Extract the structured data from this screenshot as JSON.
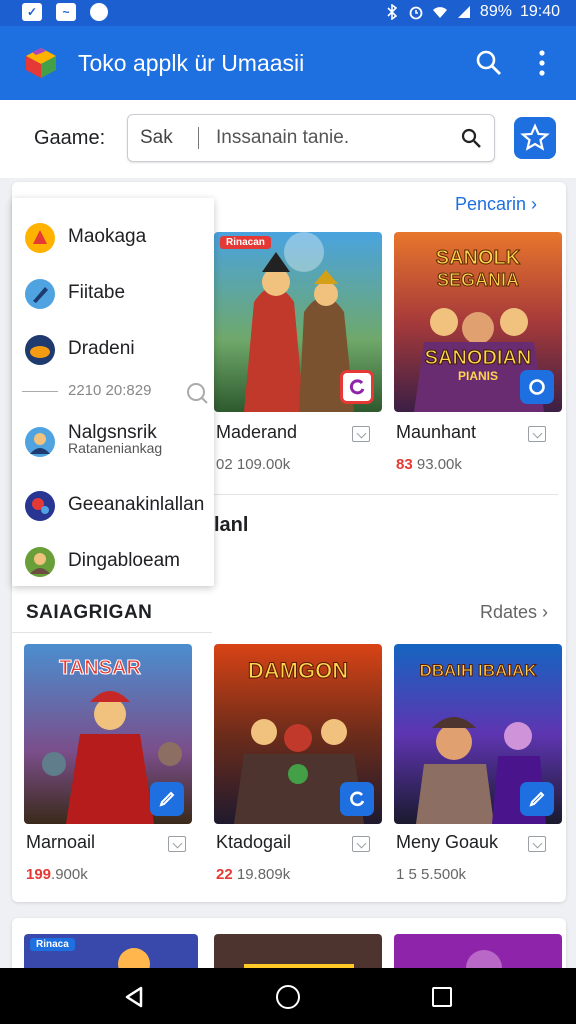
{
  "status_bar": {
    "battery": "89%",
    "time": "19:40"
  },
  "app_bar": {
    "title": "Toko applk ür Umaasii"
  },
  "filter": {
    "label": "Gaame:",
    "search_value": "Sak",
    "search_placeholder": "Inssanain tanie."
  },
  "featured": {
    "more_label": "Pencarin",
    "partial_title": "lanl",
    "tiles": [
      {
        "name": "Maderand",
        "meta_prefix": "",
        "meta": "02 109.00k",
        "tag": "Rinacan",
        "icon": "refresh-icon"
      },
      {
        "name": "Maunhant",
        "meta_prefix": "83",
        "meta": "93.00k",
        "tag": "",
        "icon": "sync-icon"
      }
    ]
  },
  "side_menu": {
    "items": [
      {
        "label": "Maokaga",
        "icon": "tag-icon"
      },
      {
        "label": "Fiitabe",
        "icon": "pencil-icon"
      },
      {
        "label": "Dradeni",
        "icon": "game-icon"
      },
      {
        "label": "Nalgsnsrik",
        "sublabel": "Rataneniankag",
        "icon": "avatar-icon"
      },
      {
        "label": "Geeanakinlallan",
        "icon": "planet-icon"
      },
      {
        "label": "Dingabloeam",
        "icon": "character-icon"
      }
    ],
    "date_text": "2210 20:829"
  },
  "section2": {
    "title": "SAIAGRIGAN",
    "more_label": "Rdates",
    "tiles": [
      {
        "name": "Marnoail",
        "meta_prefix": "199",
        "meta": ".900k",
        "art_title": "TANSAR",
        "icon": "pen-icon"
      },
      {
        "name": "Ktadogail",
        "meta_prefix": "22",
        "meta": "19.809k",
        "art_title": "DAMGON",
        "icon": "refresh-icon"
      },
      {
        "name": "Meny Goauk",
        "meta_prefix": "",
        "meta": "1 5 5.500k",
        "art_title": "DBAIH IBAIAK",
        "icon": "pen-icon"
      }
    ]
  },
  "section3": {
    "tags": [
      "Rinaca",
      "",
      ""
    ]
  },
  "colors": {
    "primary": "#1e6fe0",
    "accent_red": "#e53935"
  }
}
